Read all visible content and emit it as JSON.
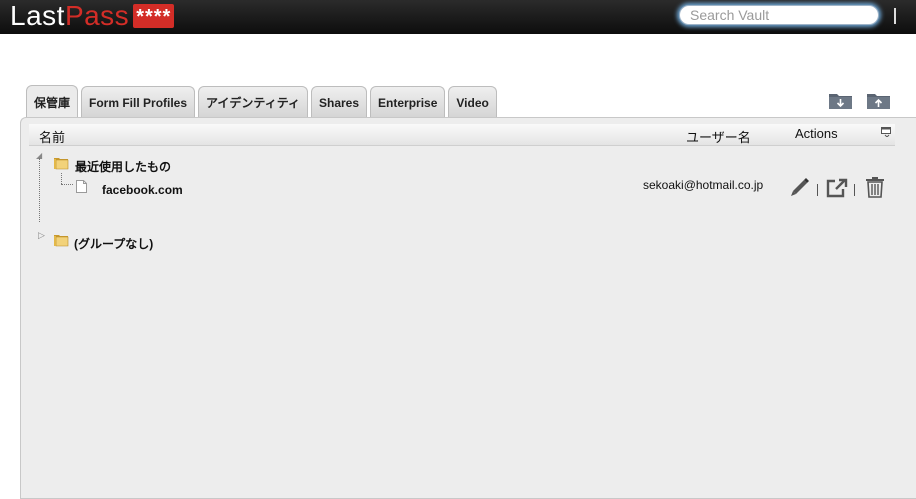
{
  "header": {
    "logo_last": "Last",
    "logo_pass": "Pass",
    "logo_stars": "****",
    "search_placeholder": "Search Vault"
  },
  "tabs": [
    {
      "label": "保管庫",
      "active": true
    },
    {
      "label": "Form Fill Profiles",
      "active": false
    },
    {
      "label": "アイデンティティ",
      "active": false
    },
    {
      "label": "Shares",
      "active": false
    },
    {
      "label": "Enterprise",
      "active": false
    },
    {
      "label": "Video",
      "active": false
    }
  ],
  "table": {
    "col_name": "名前",
    "col_username": "ユーザー名",
    "col_actions": "Actions"
  },
  "tree": {
    "recent_folder": "最近使用したもの",
    "site_name": "facebook.com",
    "site_username": "sekoaki@hotmail.co.jp",
    "no_group_folder": "(グループなし)"
  },
  "icons": {
    "folder_color": "#e7c35a",
    "brand_red": "#d32d27",
    "search_glow": "#6ea7d6"
  }
}
